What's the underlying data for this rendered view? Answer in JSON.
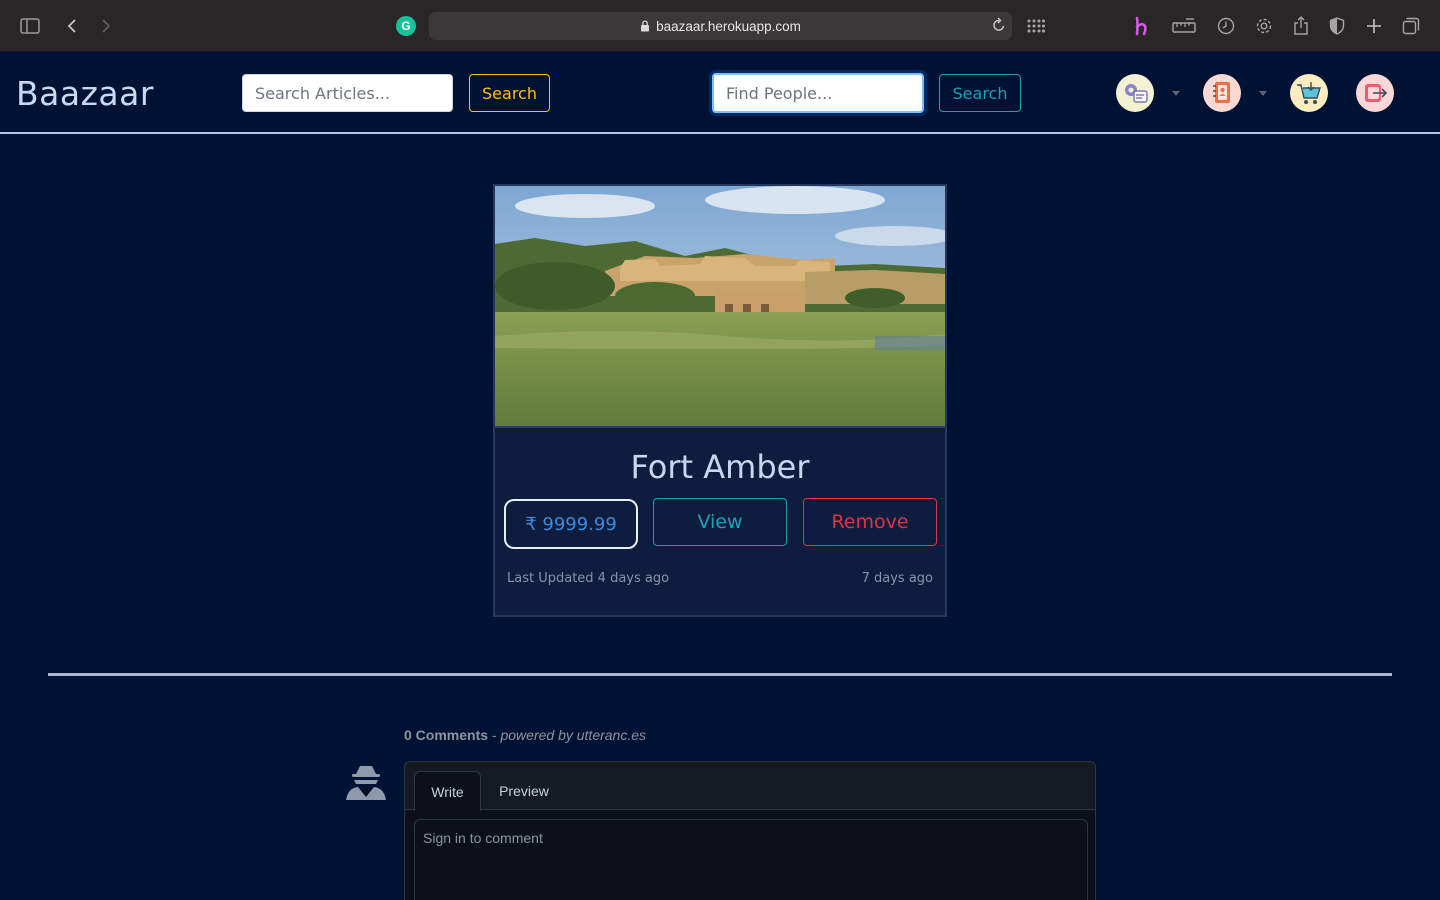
{
  "browser": {
    "url": "baazaar.herokuapp.com"
  },
  "navbar": {
    "brand": "Baazaar",
    "articles_search": {
      "placeholder": "Search Articles...",
      "button": "Search"
    },
    "people_search": {
      "placeholder": "Find People...",
      "button": "Search"
    },
    "icons": [
      "settings-profile-icon",
      "address-book-icon",
      "shopping-cart-icon",
      "logout-icon"
    ]
  },
  "card": {
    "title": "Fort Amber",
    "price": "₹ 9999.99",
    "view_label": "View",
    "remove_label": "Remove",
    "last_updated": "Last Updated 4 days ago",
    "created": "7 days ago"
  },
  "comments": {
    "count": "0 Comments",
    "separator": " - ",
    "powered_by": "powered by utteranc.es",
    "tabs": [
      "Write",
      "Preview"
    ],
    "placeholder": "Sign in to comment"
  },
  "colors": {
    "page_bg": "#001233",
    "warning": "#ffc107",
    "info": "#17a2b8",
    "danger": "#dc3545",
    "primary": "#3d8be0"
  }
}
